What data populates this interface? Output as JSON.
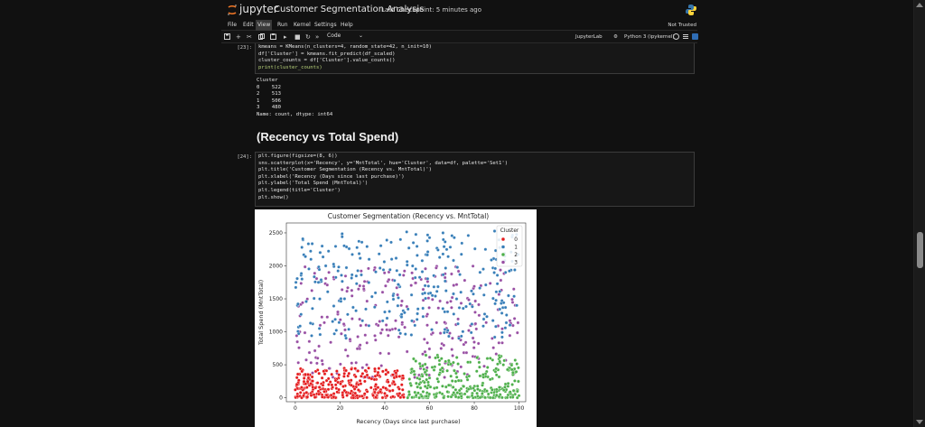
{
  "header": {
    "logo_text": "jupyter",
    "notebook_title": "Customer Segmentation Analysis",
    "checkpoint": "Last Checkpoint: 5 minutes ago"
  },
  "menu": {
    "items": [
      "File",
      "Edit",
      "View",
      "Run",
      "Kernel",
      "Settings",
      "Help"
    ],
    "active": "View",
    "trusted_label": "Not Trusted"
  },
  "toolbar": {
    "cell_type": "Code",
    "jupyterlab_label": "JupyterLab",
    "kernel_label": "Python 3 (ipykernel)",
    "icons": [
      "save-icon",
      "add-cell-icon",
      "cut-icon",
      "copy-icon",
      "paste-icon",
      "run-icon",
      "stop-icon",
      "restart-icon",
      "fast-forward-icon"
    ]
  },
  "cells": [
    {
      "prompt": "[23]:",
      "code_lines": [
        "kmeans = KMeans(n_clusters=4, random_state=42, n_init=10)",
        "df['Cluster'] = kmeans.fit_predict(df_scaled)",
        "cluster_counts = df['Cluster'].value_counts()",
        "print(cluster_counts)"
      ],
      "output_lines": [
        "Cluster",
        "0    522",
        "2    513",
        "1    506",
        "3    480",
        "Name: count, dtype: int64"
      ]
    },
    {
      "markdown_heading": "(Recency vs Total Spend)"
    },
    {
      "prompt": "[24]:",
      "code_lines": [
        "plt.figure(figsize=(8, 6))",
        "sns.scatterplot(x='Recency', y='MntTotal', hue='Cluster', data=df, palette='Set1')",
        "plt.title('Customer Segmentation (Recency vs. MntTotal)')",
        "plt.xlabel('Recency (Days since last purchase)')",
        "plt.ylabel('Total Spend (MntTotal)')",
        "plt.legend(title='Cluster')",
        "plt.show()"
      ]
    }
  ],
  "chart_data": {
    "type": "scatter",
    "title": "Customer Segmentation (Recency vs. MntTotal)",
    "xlabel": "Recency (Days since last purchase)",
    "ylabel": "Total Spend (MntTotal)",
    "xlim": [
      -4,
      103
    ],
    "ylim": [
      -60,
      2650
    ],
    "xticks": [
      0,
      20,
      40,
      60,
      80,
      100
    ],
    "yticks": [
      0,
      500,
      1000,
      1500,
      2000,
      2500
    ],
    "grid": false,
    "legend": {
      "title": "Cluster",
      "placement": "top-right",
      "entries": [
        "0",
        "1",
        "2",
        "3"
      ]
    },
    "series": [
      {
        "name": "0",
        "color": "#e41a1c",
        "count": 522,
        "x_range": [
          0,
          49
        ],
        "y_range": [
          0,
          450
        ],
        "points": [
          [
            1,
            20
          ],
          [
            5,
            80
          ],
          [
            9,
            150
          ],
          [
            14,
            40
          ],
          [
            18,
            260
          ],
          [
            22,
            110
          ],
          [
            27,
            320
          ],
          [
            31,
            60
          ],
          [
            36,
            200
          ],
          [
            41,
            30
          ],
          [
            45,
            380
          ],
          [
            48,
            120
          ],
          [
            3,
            400
          ],
          [
            12,
            300
          ],
          [
            25,
            190
          ],
          [
            38,
            90
          ],
          [
            44,
            240
          ]
        ]
      },
      {
        "name": "1",
        "color": "#377eb8",
        "count": 506,
        "x_range": [
          0,
          100
        ],
        "y_range": [
          900,
          2530
        ],
        "points": [
          [
            3,
            1800
          ],
          [
            12,
            2300
          ],
          [
            22,
            1500
          ],
          [
            33,
            2100
          ],
          [
            47,
            2400
          ],
          [
            58,
            1700
          ],
          [
            66,
            2500
          ],
          [
            74,
            1600
          ],
          [
            85,
            2250
          ],
          [
            94,
            1900
          ],
          [
            99,
            1400
          ],
          [
            40,
            1300
          ]
        ]
      },
      {
        "name": "2",
        "color": "#4daf4a",
        "count": 513,
        "x_range": [
          50,
          100
        ],
        "y_range": [
          0,
          650
        ],
        "points": [
          [
            51,
            50
          ],
          [
            56,
            150
          ],
          [
            62,
            420
          ],
          [
            68,
            90
          ],
          [
            73,
            260
          ],
          [
            79,
            30
          ],
          [
            84,
            350
          ],
          [
            88,
            120
          ],
          [
            93,
            500
          ],
          [
            97,
            200
          ],
          [
            60,
            300
          ],
          [
            90,
            40
          ]
        ]
      },
      {
        "name": "3",
        "color": "#984ea3",
        "count": 480,
        "x_range": [
          0,
          100
        ],
        "y_range": [
          300,
          2000
        ],
        "points": [
          [
            2,
            1000
          ],
          [
            10,
            600
          ],
          [
            19,
            1300
          ],
          [
            29,
            800
          ],
          [
            39,
            1600
          ],
          [
            50,
            700
          ],
          [
            59,
            1100
          ],
          [
            70,
            500
          ],
          [
            79,
            1400
          ],
          [
            88,
            900
          ],
          [
            98,
            1200
          ],
          [
            15,
            1900
          ]
        ]
      }
    ]
  }
}
